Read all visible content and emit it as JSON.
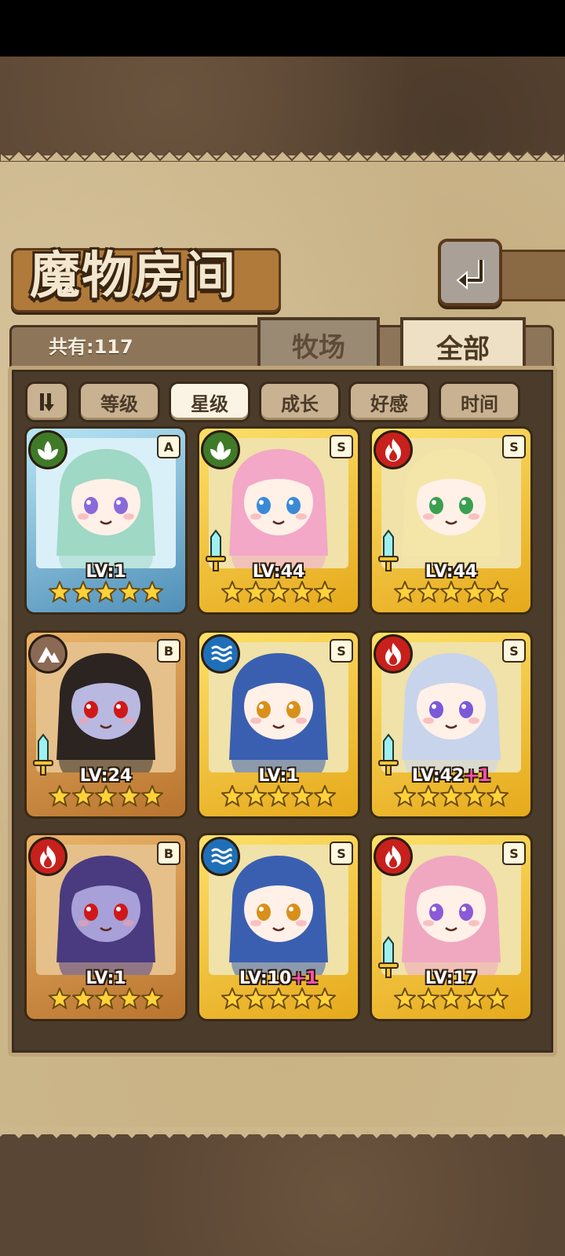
{
  "header": {
    "title": "魔物房间",
    "back_icon": "back-arrow-icon"
  },
  "summary": {
    "count_label": "共有:117"
  },
  "tabs": [
    {
      "label": "牧场",
      "active": false
    },
    {
      "label": "全部",
      "active": true
    }
  ],
  "sort": {
    "toggle_icon": "sort-order-icon",
    "buttons": [
      {
        "label": "等级",
        "active": false
      },
      {
        "label": "星级",
        "active": true
      },
      {
        "label": "成长",
        "active": false
      },
      {
        "label": "好感",
        "active": false
      },
      {
        "label": "时间",
        "active": false
      }
    ]
  },
  "monsters": [
    {
      "level": "LV:1",
      "plus": "",
      "grade": "A",
      "element": "nature",
      "frame": "blue",
      "stars": 5,
      "sword": false
    },
    {
      "level": "LV:44",
      "plus": "",
      "grade": "S",
      "element": "nature",
      "frame": "gold",
      "stars": 5,
      "sword": true
    },
    {
      "level": "LV:44",
      "plus": "",
      "grade": "S",
      "element": "fire",
      "frame": "gold",
      "stars": 5,
      "sword": true
    },
    {
      "level": "LV:24",
      "plus": "",
      "grade": "B",
      "element": "earth",
      "frame": "bronze",
      "stars": 5,
      "sword": true
    },
    {
      "level": "LV:1",
      "plus": "",
      "grade": "S",
      "element": "water",
      "frame": "gold",
      "stars": 5,
      "sword": false
    },
    {
      "level": "LV:42",
      "plus": "+1",
      "grade": "S",
      "element": "fire",
      "frame": "gold",
      "stars": 5,
      "sword": true
    },
    {
      "level": "LV:1",
      "plus": "",
      "grade": "B",
      "element": "fire",
      "frame": "bronze",
      "stars": 5,
      "sword": false
    },
    {
      "level": "LV:10",
      "plus": "+1",
      "grade": "S",
      "element": "water",
      "frame": "gold",
      "stars": 5,
      "sword": false
    },
    {
      "level": "LV:17",
      "plus": "",
      "grade": "S",
      "element": "fire",
      "frame": "gold",
      "stars": 5,
      "sword": true
    }
  ],
  "colors": {
    "fire": "#c8201c",
    "nature": "#3f7a28",
    "water": "#1f6fb8",
    "earth": "#8a6a55"
  }
}
